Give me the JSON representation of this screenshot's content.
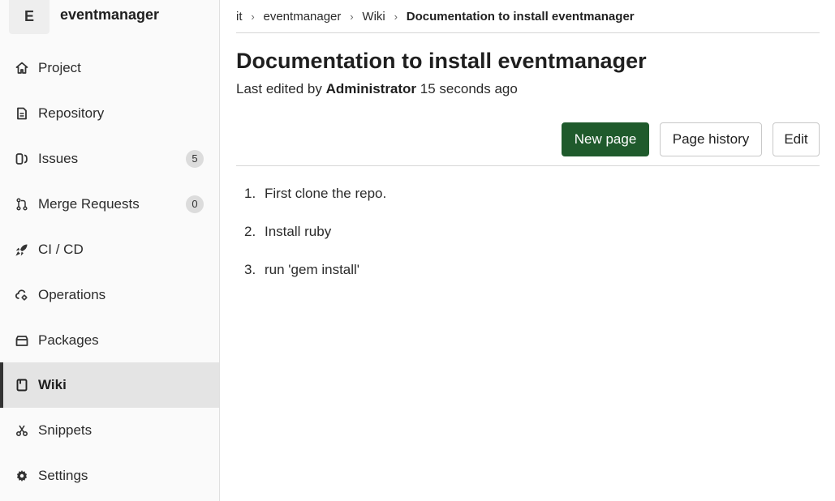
{
  "sidebar": {
    "project": {
      "avatar_letter": "E",
      "name": "eventmanager"
    },
    "items": [
      {
        "label": "Project",
        "icon": "home-icon"
      },
      {
        "label": "Repository",
        "icon": "doc-icon"
      },
      {
        "label": "Issues",
        "icon": "issues-icon",
        "count": "5"
      },
      {
        "label": "Merge Requests",
        "icon": "merge-request-icon",
        "count": "0"
      },
      {
        "label": "CI / CD",
        "icon": "rocket-icon"
      },
      {
        "label": "Operations",
        "icon": "cloud-gear-icon"
      },
      {
        "label": "Packages",
        "icon": "package-icon"
      },
      {
        "label": "Wiki",
        "icon": "book-icon",
        "active": true
      },
      {
        "label": "Snippets",
        "icon": "scissors-icon"
      },
      {
        "label": "Settings",
        "icon": "gear-icon"
      }
    ]
  },
  "breadcrumb": {
    "items": [
      "it",
      "eventmanager",
      "Wiki"
    ],
    "current": "Documentation to install eventmanager",
    "separator": "›"
  },
  "page": {
    "title": "Documentation to install eventmanager",
    "meta_prefix": "Last edited by",
    "author": "Administrator",
    "meta_suffix": "15 seconds ago"
  },
  "actions": {
    "new_page": "New page",
    "page_history": "Page history",
    "edit": "Edit"
  },
  "content": {
    "steps": [
      {
        "num": "1.",
        "text": "First clone the repo."
      },
      {
        "num": "2.",
        "text": "Install ruby"
      },
      {
        "num": "3.",
        "text": "run 'gem install'"
      }
    ]
  },
  "colors": {
    "primary_button": "#1f5a2c",
    "sidebar_bg": "#fafafa",
    "active_bg": "#e4e4e4"
  }
}
